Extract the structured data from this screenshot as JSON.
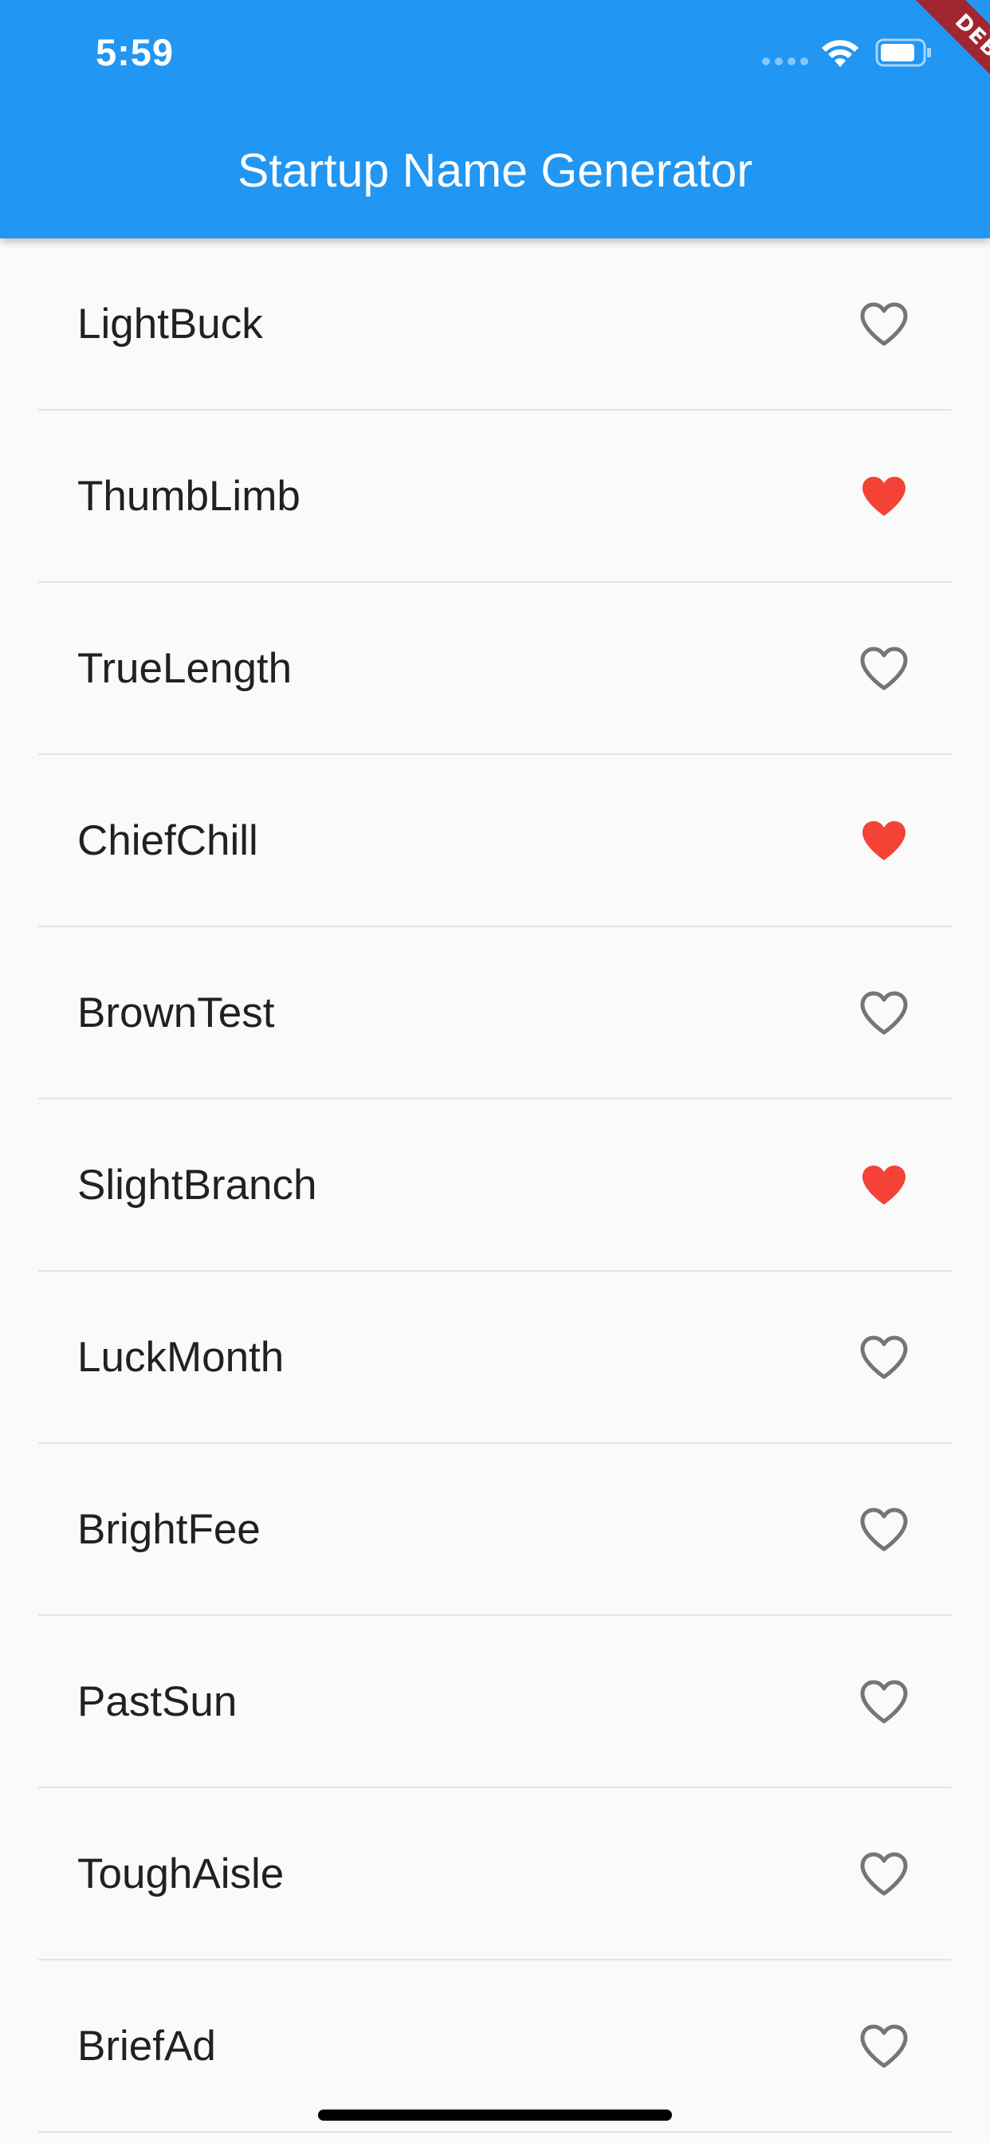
{
  "status_bar": {
    "time": "5:59",
    "icons": [
      "cellular-signal-icon",
      "wifi-icon",
      "battery-icon"
    ]
  },
  "debug_banner": "DEBUG",
  "app_bar": {
    "title": "Startup Name Generator",
    "color": "#2196f3"
  },
  "colors": {
    "favorite": "#f44336",
    "not_favorite": "#757575"
  },
  "list": {
    "items": [
      {
        "label": "LightBuck",
        "favorited": false
      },
      {
        "label": "ThumbLimb",
        "favorited": true
      },
      {
        "label": "TrueLength",
        "favorited": false
      },
      {
        "label": "ChiefChill",
        "favorited": true
      },
      {
        "label": "BrownTest",
        "favorited": false
      },
      {
        "label": "SlightBranch",
        "favorited": true
      },
      {
        "label": "LuckMonth",
        "favorited": false
      },
      {
        "label": "BrightFee",
        "favorited": false
      },
      {
        "label": "PastSun",
        "favorited": false
      },
      {
        "label": "ToughAisle",
        "favorited": false
      },
      {
        "label": "BriefAd",
        "favorited": false
      }
    ]
  }
}
